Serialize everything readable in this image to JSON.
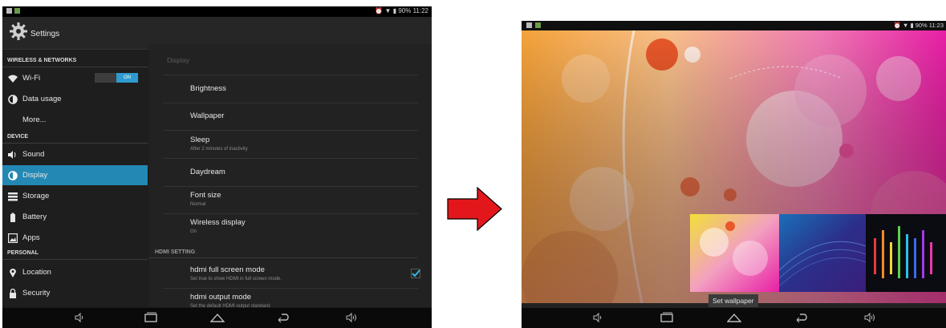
{
  "left_tablet": {
    "status_time": "90% 11:22",
    "title": "Settings",
    "sections": {
      "wireless": "WIRELESS & NETWORKS",
      "device": "DEVICE",
      "personal": "PERSONAL"
    },
    "menu": {
      "wifi": "Wi-Fi",
      "wifi_toggle": "ON",
      "data_usage": "Data usage",
      "more": "More...",
      "sound": "Sound",
      "display": "Display",
      "storage": "Storage",
      "battery": "Battery",
      "apps": "Apps",
      "location": "Location",
      "security": "Security"
    },
    "display_panel": {
      "header": "Display",
      "brightness": "Brightness",
      "wallpaper": "Wallpaper",
      "sleep": "Sleep",
      "sleep_sub": "After 2 minutes of inactivity",
      "daydream": "Daydream",
      "font_size": "Font size",
      "font_size_sub": "Normal",
      "wireless_display": "Wireless display",
      "wireless_display_sub": "On",
      "hdmi_section": "HDMI SETTING",
      "hdmi_full": "hdmi full screen mode",
      "hdmi_full_sub": "Set true to show HDMI in full screen mode.",
      "hdmi_full_checked": true,
      "hdmi_output": "hdmi output mode",
      "hdmi_output_sub": "Set the default HDMI output standard."
    }
  },
  "arrow_color": "#e3171b",
  "right_tablet": {
    "status_time": "90% 11:23",
    "set_wallpaper": "Set wallpaper"
  },
  "icons": [
    "gear-icon",
    "wifi-icon",
    "data-usage-icon",
    "sound-icon",
    "display-icon",
    "storage-icon",
    "battery-icon",
    "apps-icon",
    "location-icon",
    "security-icon",
    "volume-down-icon",
    "recent-apps-icon",
    "home-icon",
    "back-icon",
    "volume-up-icon",
    "check-icon"
  ]
}
